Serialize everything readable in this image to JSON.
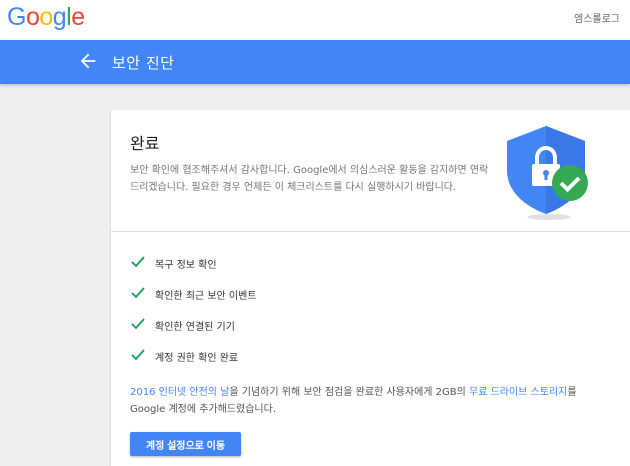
{
  "header": {
    "logo_letters": [
      {
        "char": "G",
        "color": "#4285f4"
      },
      {
        "char": "o",
        "color": "#ea4335"
      },
      {
        "char": "o",
        "color": "#fbbc05"
      },
      {
        "char": "g",
        "color": "#4285f4"
      },
      {
        "char": "l",
        "color": "#34a853"
      },
      {
        "char": "e",
        "color": "#ea4335"
      }
    ],
    "account_name": "엠스롤로그"
  },
  "toolbar": {
    "back_icon": "arrow-back-icon",
    "title": "보안 진단",
    "color": "#4285f4"
  },
  "card": {
    "title": "완료",
    "description": "보안 확인에 협조해주셔서 감사합니다. Google에서 의심스러운 활동을 감지하면 연락드리겠습니다. 필요한 경우 언제든 이 체크리스트를 다시 실행하시기 바랍니다.",
    "illustration_icon": "shield-lock-check-icon",
    "checklist": [
      "복구 정보 확인",
      "확인한 최근 보안 이벤트",
      "확인한 연결된 기기",
      "계정 권한 확인 완료"
    ],
    "promo": {
      "link1": "2016 인터넷 안전의 날",
      "text1": "을 기념하기 위해 보안 점검을 완료한 사용자에게 2GB의 ",
      "link2": "무료 드라이브 스토리지",
      "text2": "를 Google 계정에 추가해드렸습니다."
    },
    "button_label": "계정 설정으로 이동"
  }
}
